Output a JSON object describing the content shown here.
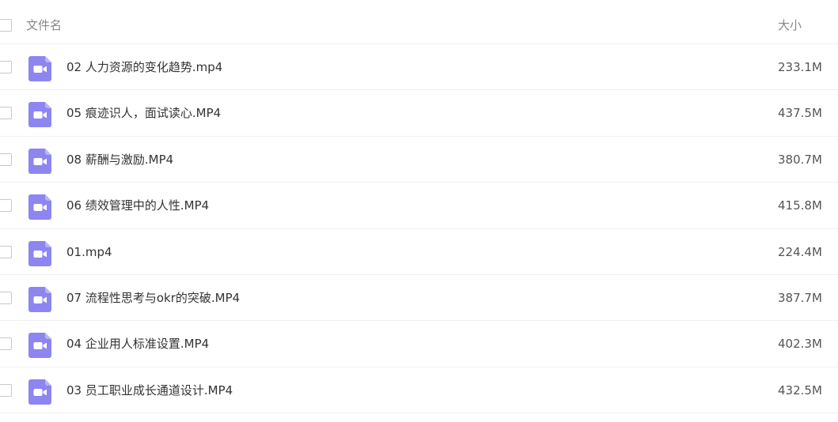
{
  "header": {
    "name_label": "文件名",
    "size_label": "大小"
  },
  "colors": {
    "icon_fill": "#8d86f0",
    "icon_fold": "#b9b4f7",
    "divider": "#f0f0f0"
  },
  "files": [
    {
      "name": "02 人力资源的变化趋势.mp4",
      "size": "233.1M",
      "icon": "video-file-icon"
    },
    {
      "name": "05 痕迹识人，面试读心.MP4",
      "size": "437.5M",
      "icon": "video-file-icon"
    },
    {
      "name": "08 薪酬与激励.MP4",
      "size": "380.7M",
      "icon": "video-file-icon"
    },
    {
      "name": "06 绩效管理中的人性.MP4",
      "size": "415.8M",
      "icon": "video-file-icon"
    },
    {
      "name": "01.mp4",
      "size": "224.4M",
      "icon": "video-file-icon"
    },
    {
      "name": "07 流程性思考与okr的突破.MP4",
      "size": "387.7M",
      "icon": "video-file-icon"
    },
    {
      "name": "04 企业用人标准设置.MP4",
      "size": "402.3M",
      "icon": "video-file-icon"
    },
    {
      "name": "03 员工职业成长通道设计.MP4",
      "size": "432.5M",
      "icon": "video-file-icon"
    }
  ]
}
